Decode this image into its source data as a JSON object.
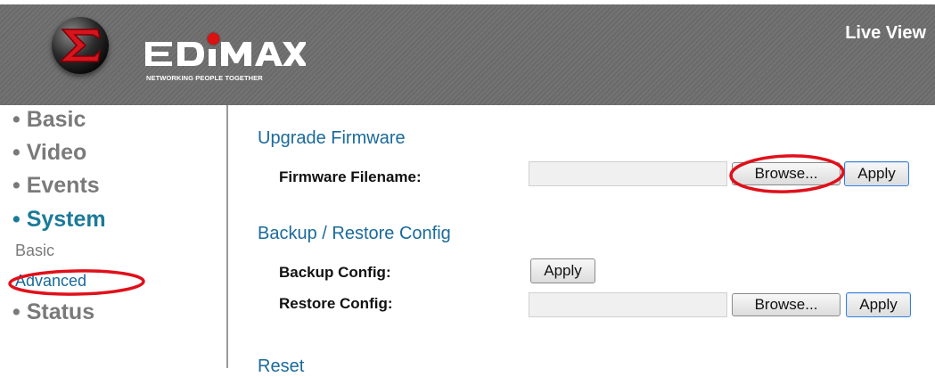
{
  "header": {
    "brand_name": "EDIMAX",
    "tagline": "NETWORKING PEOPLE TOGETHER",
    "live_view": "Live View",
    "logo_icon": "sigma-logo-icon"
  },
  "sidebar": {
    "items": [
      {
        "label": "• Basic",
        "active": false
      },
      {
        "label": "• Video",
        "active": false
      },
      {
        "label": "• Events",
        "active": false
      },
      {
        "label": "• System",
        "active": true
      },
      {
        "label": "• Status",
        "active": false
      }
    ],
    "system_subitems": [
      {
        "label": "Basic",
        "active": false
      },
      {
        "label": "Advanced",
        "active": true
      }
    ]
  },
  "main": {
    "upgrade": {
      "title": "Upgrade Firmware",
      "firmware_label": "Firmware Filename:",
      "firmware_value": "",
      "browse_label": "Browse...",
      "apply_label": "Apply"
    },
    "backup": {
      "title": "Backup / Restore Config",
      "backup_label": "Backup Config:",
      "backup_apply_label": "Apply",
      "restore_label": "Restore Config:",
      "restore_value": "",
      "restore_browse_label": "Browse...",
      "restore_apply_label": "Apply"
    },
    "reset": {
      "title": "Reset"
    }
  },
  "colors": {
    "header_bg": "#6e6e6e",
    "nav_gray": "#7a7a7a",
    "nav_active": "#1a7a9a",
    "section_blue": "#1a6a9a",
    "annotation_red": "#e0101a"
  }
}
